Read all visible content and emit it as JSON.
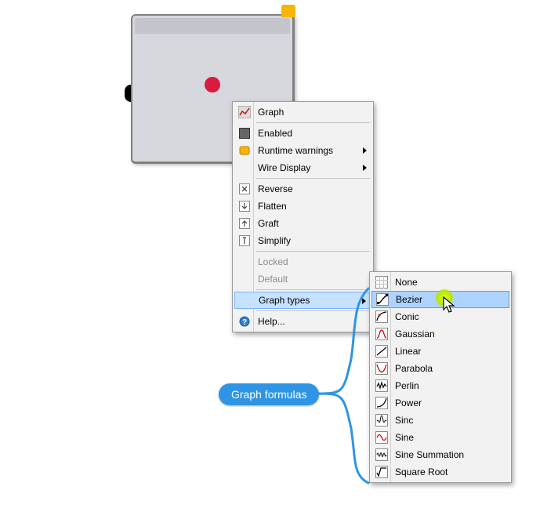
{
  "callout": {
    "label": "Graph formulas"
  },
  "menu": {
    "header": "Graph",
    "items": [
      {
        "label": "Enabled",
        "icon": "enabled-icon"
      },
      {
        "label": "Runtime warnings",
        "icon": "warning-icon",
        "sub": true
      },
      {
        "label": "Wire Display",
        "sub": true
      },
      {
        "label": "Reverse",
        "icon": "reverse-icon"
      },
      {
        "label": "Flatten",
        "icon": "flatten-icon"
      },
      {
        "label": "Graft",
        "icon": "graft-icon"
      },
      {
        "label": "Simplify",
        "icon": "simplify-icon"
      },
      {
        "label": "Locked",
        "disabled": true
      },
      {
        "label": "Default",
        "disabled": true
      },
      {
        "label": "Graph types",
        "sub": true,
        "highlight": true
      },
      {
        "label": "Help...",
        "icon": "help-icon"
      }
    ]
  },
  "submenu": {
    "items": [
      {
        "label": "None",
        "icon": "none-icon"
      },
      {
        "label": "Bezier",
        "icon": "bezier-icon",
        "highlight": true
      },
      {
        "label": "Conic",
        "icon": "conic-icon"
      },
      {
        "label": "Gaussian",
        "icon": "gaussian-icon"
      },
      {
        "label": "Linear",
        "icon": "linear-icon"
      },
      {
        "label": "Parabola",
        "icon": "parabola-icon"
      },
      {
        "label": "Perlin",
        "icon": "perlin-icon"
      },
      {
        "label": "Power",
        "icon": "power-icon"
      },
      {
        "label": "Sinc",
        "icon": "sinc-icon"
      },
      {
        "label": "Sine",
        "icon": "sine-icon"
      },
      {
        "label": "Sine Summation",
        "icon": "sinesum-icon"
      },
      {
        "label": "Square Root",
        "icon": "sqrt-icon"
      }
    ]
  }
}
